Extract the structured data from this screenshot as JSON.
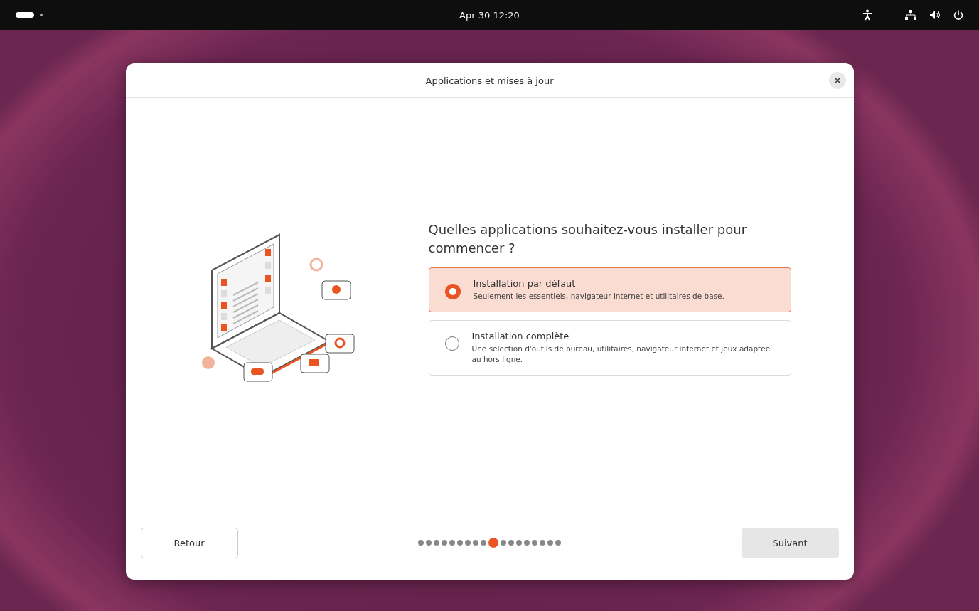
{
  "top_bar": {
    "clock": "Apr 30 12:20"
  },
  "dialog": {
    "title": "Applications et mises à jour",
    "question": "Quelles applications souhaitez-vous installer pour commencer ?",
    "options": [
      {
        "title": "Installation par défaut",
        "description": "Seulement les essentiels, navigateur internet et utilitaires de base.",
        "selected": true
      },
      {
        "title": "Installation complète",
        "description": "Une sélection d'outils de bureau, utilitaires, navigateur internet et jeux adaptée au hors ligne.",
        "selected": false
      }
    ],
    "back_button": "Retour",
    "next_button": "Suivant",
    "steps": [
      {
        "selected": false
      },
      {
        "selected": false
      },
      {
        "selected": false
      },
      {
        "selected": false
      },
      {
        "selected": false
      },
      {
        "selected": false
      },
      {
        "selected": false
      },
      {
        "selected": false
      },
      {
        "selected": false
      },
      {
        "selected": true
      },
      {
        "selected": false
      },
      {
        "selected": false
      },
      {
        "selected": false
      },
      {
        "selected": false
      },
      {
        "selected": false
      },
      {
        "selected": false
      },
      {
        "selected": false
      },
      {
        "selected": false
      }
    ]
  }
}
